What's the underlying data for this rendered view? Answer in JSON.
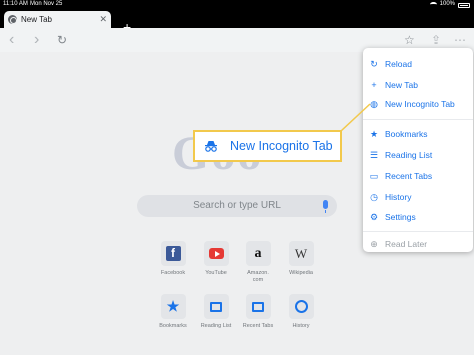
{
  "status_bar": {
    "time": "11:10 AM",
    "date": "Mon Nov 25",
    "battery": "100%"
  },
  "tab": {
    "title": "New Tab",
    "close": "✕"
  },
  "new_tab_glyph": "+",
  "toolbar": {
    "back": "‹",
    "forward": "›",
    "reload": "↻",
    "star": "☆",
    "share": "⇪",
    "more": "⋯"
  },
  "search": {
    "placeholder": "Search or type URL"
  },
  "logo": "Goo",
  "tiles": [
    {
      "label": "Facebook",
      "glyph": "f"
    },
    {
      "label": "YouTube",
      "glyph": ""
    },
    {
      "label": "Amazon.\ncom",
      "glyph": "a"
    },
    {
      "label": "Wikipedia",
      "glyph": "W"
    },
    {
      "label": "Bookmarks",
      "glyph": "★"
    },
    {
      "label": "Reading List",
      "glyph": ""
    },
    {
      "label": "Recent Tabs",
      "glyph": ""
    },
    {
      "label": "History",
      "glyph": ""
    }
  ],
  "menu": {
    "items": [
      {
        "label": "Reload",
        "icon": "↻"
      },
      {
        "label": "New Tab",
        "icon": "+"
      },
      {
        "label": "New Incognito Tab",
        "icon": "◍"
      },
      {
        "label": "Bookmarks",
        "icon": "★"
      },
      {
        "label": "Reading List",
        "icon": "☰"
      },
      {
        "label": "Recent Tabs",
        "icon": "▭"
      },
      {
        "label": "History",
        "icon": "◷"
      },
      {
        "label": "Settings",
        "icon": "⚙"
      },
      {
        "label": "Read Later",
        "icon": "⊕"
      }
    ]
  },
  "callout": {
    "label": "New Incognito Tab"
  },
  "colors": {
    "accent": "#1a73e8",
    "highlight": "#f2c94c"
  }
}
